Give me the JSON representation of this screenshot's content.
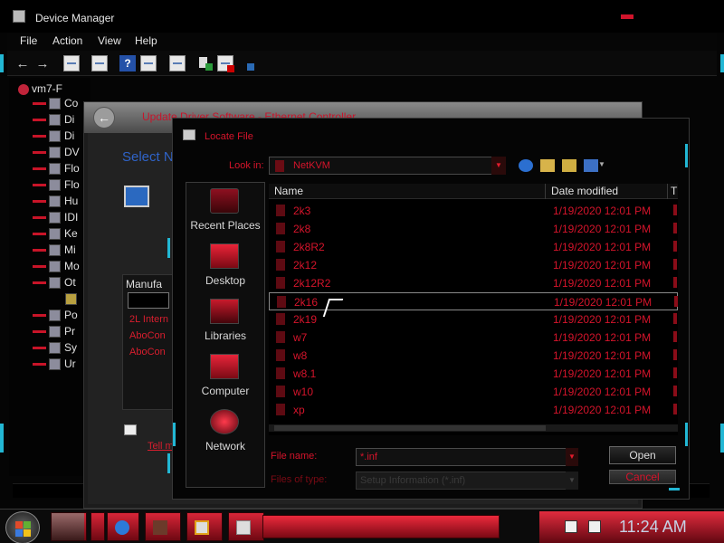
{
  "device_manager": {
    "title": "Device Manager",
    "menu": [
      "File",
      "Action",
      "View",
      "Help"
    ],
    "tree_root": "vm7-F",
    "tree_items": [
      "Co",
      "Di",
      "Di",
      "DV",
      "Flo",
      "Flo",
      "Hu",
      "IDI",
      "Ke",
      "Mi",
      "Mo",
      "Ot",
      "",
      "Po",
      "Pr",
      "Sy",
      "Ur"
    ]
  },
  "wizard": {
    "title": "Update Driver Software - Ethernet Controller",
    "heading": "Select N",
    "manufacturer_header": "Manufa",
    "manufacturers": [
      "2L Intern",
      "AboCon",
      "AboCon"
    ],
    "link": "Tell m"
  },
  "locate_file": {
    "title": "Locate File",
    "look_in_label": "Look in:",
    "look_in_value": "NetKVM",
    "places": [
      "Recent Places",
      "Desktop",
      "Libraries",
      "Computer",
      "Network"
    ],
    "columns": [
      "Name",
      "Date modified",
      "T"
    ],
    "files": [
      {
        "name": "2k3",
        "date": "1/19/2020 12:01 PM"
      },
      {
        "name": "2k8",
        "date": "1/19/2020 12:01 PM"
      },
      {
        "name": "2k8R2",
        "date": "1/19/2020 12:01 PM"
      },
      {
        "name": "2k12",
        "date": "1/19/2020 12:01 PM"
      },
      {
        "name": "2k12R2",
        "date": "1/19/2020 12:01 PM"
      },
      {
        "name": "2k16",
        "date": "1/19/2020 12:01 PM",
        "selected": true
      },
      {
        "name": "2k19",
        "date": "1/19/2020 12:01 PM"
      },
      {
        "name": "w7",
        "date": "1/19/2020 12:01 PM"
      },
      {
        "name": "w8",
        "date": "1/19/2020 12:01 PM"
      },
      {
        "name": "w8.1",
        "date": "1/19/2020 12:01 PM"
      },
      {
        "name": "w10",
        "date": "1/19/2020 12:01 PM"
      },
      {
        "name": "xp",
        "date": "1/19/2020 12:01 PM"
      }
    ],
    "file_name_label": "File name:",
    "file_name_value": "*.inf",
    "files_of_type_label": "Files of type:",
    "files_of_type_value": "Setup Information (*.inf)",
    "open_label": "Open",
    "cancel_label": "Cancel"
  },
  "taskbar": {
    "clock": "11:24 AM"
  },
  "colors": {
    "accent_red": "#d5142b",
    "accent_cyan": "#22b7d4",
    "link_blue": "#2f63c8"
  }
}
